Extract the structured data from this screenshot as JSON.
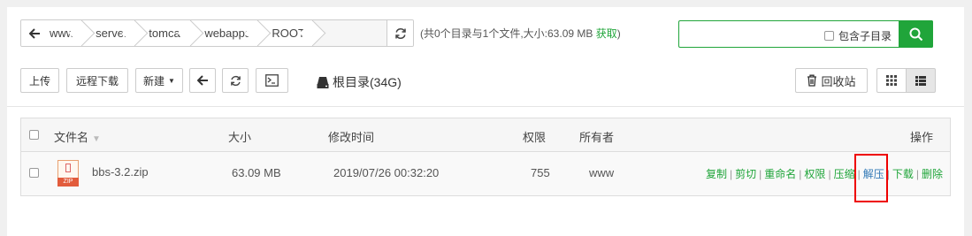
{
  "path": {
    "crumbs": [
      "www",
      "server",
      "tomcat",
      "webapps",
      "ROOT"
    ],
    "summary": "(共0个目录与1个文件,大小:63.09 MB ",
    "summary_link": "获取",
    "summary_end": ")"
  },
  "search": {
    "include_sub_label": "包含子目录",
    "placeholder": ""
  },
  "toolbar": {
    "upload": "上传",
    "remote_download": "远程下载",
    "new": "新建",
    "disk": "根目录(34G)",
    "recycle": "回收站"
  },
  "table": {
    "headers": {
      "name": "文件名",
      "size": "大小",
      "mtime": "修改时间",
      "perm": "权限",
      "owner": "所有者",
      "ops": "操作"
    },
    "rows": [
      {
        "name": "bbs-3.2.zip",
        "size": "63.09 MB",
        "mtime": "2019/07/26 00:32:20",
        "perm": "755",
        "owner": "www",
        "ext": "ZIP"
      }
    ],
    "actions": [
      "复制",
      "剪切",
      "重命名",
      "权限",
      "压缩",
      "解压",
      "下载",
      "删除"
    ]
  },
  "colors": {
    "accent": "#20a53a",
    "highlight_box": "#e00000"
  }
}
